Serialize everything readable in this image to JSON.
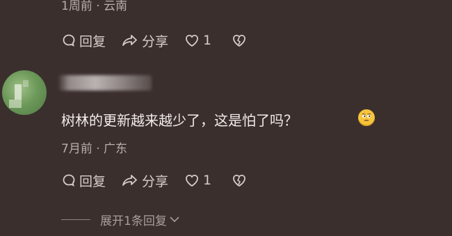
{
  "comments": [
    {
      "meta": "1周前 · 云南",
      "reply_label": "回复",
      "share_label": "分享",
      "like_count": "1"
    },
    {
      "text": "树林的更新越来越少了，这是怕了吗？",
      "meta": "7月前 · 广东",
      "reply_label": "回复",
      "share_label": "分享",
      "like_count": "1"
    }
  ],
  "expand_replies": "展开1条回复",
  "icons": [
    "reply-icon",
    "share-icon",
    "heart-icon",
    "broken-heart-icon",
    "emoji-thinking-icon",
    "chevron-down-icon"
  ]
}
